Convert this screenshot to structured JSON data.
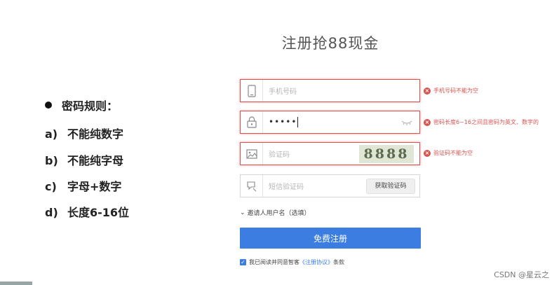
{
  "title": "注册抢88现金",
  "rules": {
    "heading": "密码规则：",
    "items": [
      {
        "marker": "a)",
        "text": "不能纯数字"
      },
      {
        "marker": "b)",
        "text": "不能纯字母"
      },
      {
        "marker": "c)",
        "text": "字母+数字"
      },
      {
        "marker": "d)",
        "text": "长度6-16位"
      }
    ]
  },
  "form": {
    "phone": {
      "placeholder": "手机号码",
      "error": "手机号码不能为空",
      "icon": "phone-icon"
    },
    "password": {
      "value": "•••••",
      "error": "密码长度6~16之间且密码为英文、数字的",
      "icon": "lock-icon",
      "toggle_icon": "eye-closed-icon"
    },
    "captcha": {
      "placeholder": "验证码",
      "error": "验证码不能为空",
      "image_text": "8888",
      "icon": "image-icon"
    },
    "sms": {
      "placeholder": "短信验证码",
      "button": "获取验证码",
      "icon": "message-icon"
    },
    "invite": "邀请人用户名（选填）",
    "submit": "免费注册",
    "agree": {
      "prefix": "我已阅读并同意智客",
      "link": "《注册协议》",
      "suffix": "条款",
      "checked": true
    }
  },
  "watermark": "CSDN @星云之",
  "colors": {
    "accent": "#3b7de0",
    "error": "#d9534f"
  }
}
